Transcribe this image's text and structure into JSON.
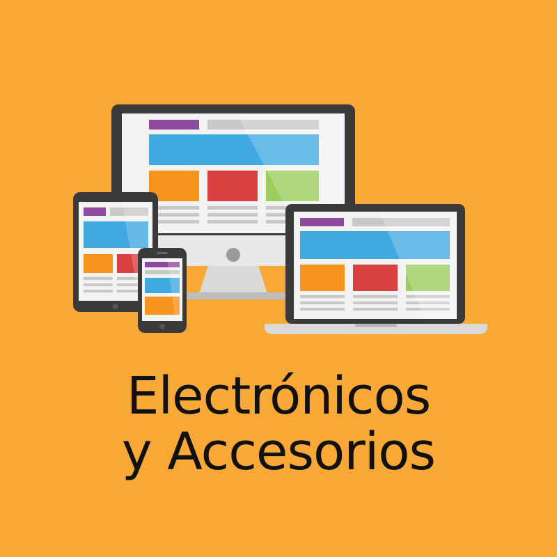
{
  "caption": {
    "line1": "Electrónicos",
    "line2": "y Accesorios"
  },
  "colors": {
    "background": "#F8A837",
    "frame": "#3a3a3a",
    "screen": "#f2f2f2",
    "purple": "#8E4A9E",
    "blue": "#3FA9E0",
    "orange": "#F7941D",
    "red": "#D9403F",
    "green": "#9ACD5C",
    "gray": "#c8c8c8"
  },
  "illustration": {
    "icons": [
      "desktop-monitor-icon",
      "laptop-icon",
      "tablet-icon",
      "smartphone-icon"
    ]
  }
}
